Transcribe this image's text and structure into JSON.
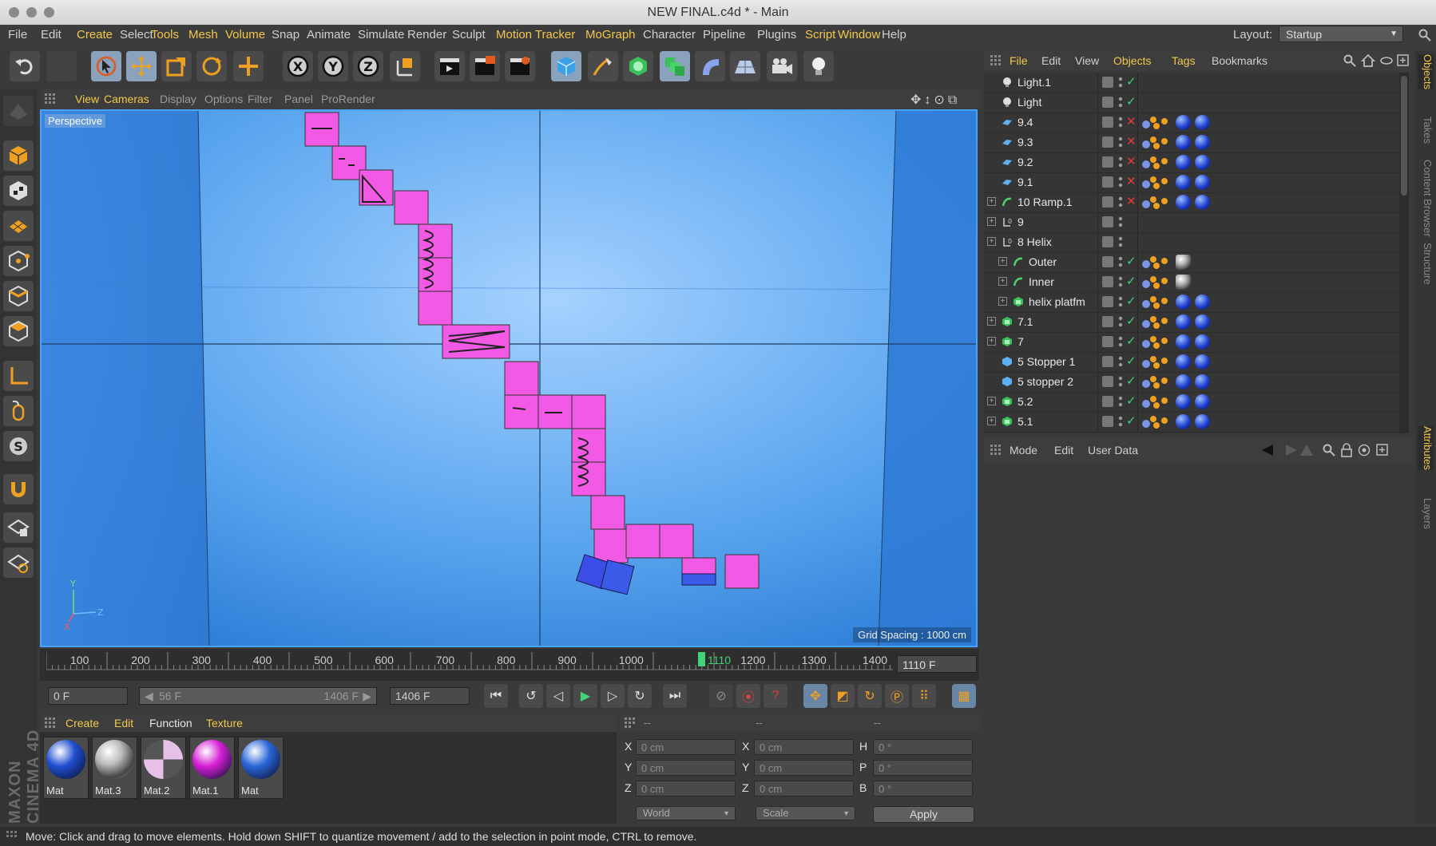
{
  "window": {
    "title": "NEW FINAL.c4d * - Main"
  },
  "menubar": {
    "items": [
      {
        "label": "File",
        "hl": false
      },
      {
        "label": "Edit",
        "hl": false
      },
      {
        "label": "Create",
        "hl": true
      },
      {
        "label": "Select",
        "hl": false
      },
      {
        "label": "Tools",
        "hl": true
      },
      {
        "label": "Mesh",
        "hl": true
      },
      {
        "label": "Volume",
        "hl": true
      },
      {
        "label": "Snap",
        "hl": false
      },
      {
        "label": "Animate",
        "hl": false
      },
      {
        "label": "Simulate",
        "hl": false
      },
      {
        "label": "Render",
        "hl": false
      },
      {
        "label": "Sculpt",
        "hl": false
      },
      {
        "label": "Motion Tracker",
        "hl": true
      },
      {
        "label": "MoGraph",
        "hl": true
      },
      {
        "label": "Character",
        "hl": false
      },
      {
        "label": "Pipeline",
        "hl": false
      },
      {
        "label": "Plugins",
        "hl": false
      },
      {
        "label": "Script",
        "hl": true
      },
      {
        "label": "Window",
        "hl": true
      },
      {
        "label": "Help",
        "hl": false
      }
    ],
    "layout_label": "Layout:",
    "layout_value": "Startup"
  },
  "viewport": {
    "menu": [
      {
        "label": "View",
        "hl": true
      },
      {
        "label": "Cameras",
        "hl": true
      },
      {
        "label": "Display",
        "hl": false
      },
      {
        "label": "Options",
        "hl": false
      },
      {
        "label": "Filter",
        "hl": false
      },
      {
        "label": "Panel",
        "hl": false
      },
      {
        "label": "ProRender",
        "hl": false
      }
    ],
    "camera_label": "Perspective",
    "grid_spacing": "Grid Spacing : 1000 cm",
    "axis_y": "Y",
    "axis_x": "X",
    "axis_z": "Z"
  },
  "timeline": {
    "ticks": [
      "100",
      "200",
      "300",
      "400",
      "500",
      "600",
      "700",
      "800",
      "900",
      "1000",
      "1100",
      "1200",
      "1300",
      "1400"
    ],
    "current_marker": "1110",
    "current_frame": "1110 F"
  },
  "transport": {
    "start_frame": "0 F",
    "range_start": "56 F",
    "range_end": "1406 F",
    "end_frame": "1406 F"
  },
  "materials": {
    "menu": [
      {
        "label": "Create",
        "hl": true
      },
      {
        "label": "Edit",
        "hl": true
      },
      {
        "label": "Function",
        "hl": false
      },
      {
        "label": "Texture",
        "hl": true
      }
    ],
    "items": [
      {
        "label": "Mat",
        "color": "#1f4fd0"
      },
      {
        "label": "Mat.3",
        "color": "#bfbfbf"
      },
      {
        "label": "Mat.2",
        "color": "#d9a0d9"
      },
      {
        "label": "Mat.1",
        "color": "#d61fd6"
      },
      {
        "label": "Mat",
        "color": "#2a66d8"
      }
    ],
    "brand": "MAXON CINEMA 4D"
  },
  "coordinates": {
    "headers": [
      "--",
      "--",
      "--"
    ],
    "rows": [
      {
        "l1": "X",
        "v1": "0 cm",
        "l2": "X",
        "v2": "0 cm",
        "l3": "H",
        "v3": "0 °"
      },
      {
        "l1": "Y",
        "v1": "0 cm",
        "l2": "Y",
        "v2": "0 cm",
        "l3": "P",
        "v3": "0 °"
      },
      {
        "l1": "Z",
        "v1": "0 cm",
        "l2": "Z",
        "v2": "0 cm",
        "l3": "B",
        "v3": "0 °"
      }
    ],
    "mode1": "World",
    "mode2": "Scale",
    "apply": "Apply"
  },
  "status": "Move: Click and drag to move elements. Hold down SHIFT to quantize movement / add to the selection in point mode, CTRL to remove.",
  "objects": {
    "menu": [
      {
        "label": "File",
        "hl": true
      },
      {
        "label": "Edit",
        "hl": false
      },
      {
        "label": "View",
        "hl": false
      },
      {
        "label": "Objects",
        "hl": true
      },
      {
        "label": "Tags",
        "hl": true
      },
      {
        "label": "Bookmarks",
        "hl": false
      }
    ],
    "rows": [
      {
        "name": "Light.1",
        "kind": "light",
        "indent": 0,
        "exp": false,
        "check": "green",
        "tags": []
      },
      {
        "name": "Light",
        "kind": "light",
        "indent": 0,
        "exp": false,
        "check": "green",
        "tags": []
      },
      {
        "name": "9.4",
        "kind": "plane",
        "indent": 0,
        "exp": false,
        "check": "red",
        "tags": [
          "dyn",
          "ball",
          "ball"
        ]
      },
      {
        "name": "9.3",
        "kind": "plane",
        "indent": 0,
        "exp": false,
        "check": "red",
        "tags": [
          "dyn",
          "ball",
          "ball"
        ]
      },
      {
        "name": "9.2",
        "kind": "plane",
        "indent": 0,
        "exp": false,
        "check": "red",
        "tags": [
          "dyn",
          "ball",
          "ball"
        ]
      },
      {
        "name": "9.1",
        "kind": "plane",
        "indent": 0,
        "exp": false,
        "check": "red",
        "tags": [
          "dyn",
          "ball",
          "ball"
        ]
      },
      {
        "name": "10 Ramp.1",
        "kind": "spline",
        "indent": 0,
        "exp": true,
        "check": "red",
        "tags": [
          "dyn",
          "ball",
          "ball"
        ]
      },
      {
        "name": "9",
        "kind": "null",
        "indent": 0,
        "exp": true,
        "check": "none",
        "tags": []
      },
      {
        "name": "8 Helix",
        "kind": "null",
        "indent": 0,
        "exp": true,
        "check": "none",
        "tags": []
      },
      {
        "name": "Outer",
        "kind": "spline",
        "indent": 1,
        "exp": true,
        "check": "green",
        "tags": [
          "dyn",
          "chrome"
        ]
      },
      {
        "name": "Inner",
        "kind": "spline",
        "indent": 1,
        "exp": true,
        "check": "green",
        "tags": [
          "dyn",
          "chrome"
        ]
      },
      {
        "name": "helix platfm",
        "kind": "cube",
        "indent": 1,
        "exp": true,
        "check": "green",
        "tags": [
          "dyn",
          "ball",
          "ball"
        ]
      },
      {
        "name": "7.1",
        "kind": "cube",
        "indent": 0,
        "exp": true,
        "check": "green",
        "tags": [
          "dyn",
          "ball",
          "ball"
        ]
      },
      {
        "name": "7",
        "kind": "cube",
        "indent": 0,
        "exp": true,
        "check": "green",
        "tags": [
          "dyn",
          "ball",
          "ball"
        ]
      },
      {
        "name": "5 Stopper 1",
        "kind": "box",
        "indent": 0,
        "exp": false,
        "check": "green",
        "tags": [
          "dyn",
          "ball",
          "ball"
        ]
      },
      {
        "name": "5 stopper 2",
        "kind": "box",
        "indent": 0,
        "exp": false,
        "check": "green",
        "tags": [
          "dyn",
          "ball",
          "ball"
        ]
      },
      {
        "name": "5.2",
        "kind": "cube",
        "indent": 0,
        "exp": true,
        "check": "green",
        "tags": [
          "dyn",
          "ball",
          "ball"
        ]
      },
      {
        "name": "5.1",
        "kind": "cube",
        "indent": 0,
        "exp": true,
        "check": "green",
        "tags": [
          "dyn",
          "ball",
          "ball"
        ]
      }
    ]
  },
  "attributes": {
    "menu": [
      "Mode",
      "Edit",
      "User Data"
    ]
  },
  "side_tabs": [
    {
      "label": "Objects",
      "hl": true
    },
    {
      "label": "Takes",
      "hl": false
    },
    {
      "label": "Content Browser",
      "hl": false
    },
    {
      "label": "Structure",
      "hl": false
    },
    {
      "label": "Attributes",
      "hl": true
    },
    {
      "label": "Layers",
      "hl": false
    }
  ],
  "colors": {
    "accent": "#f2c84b",
    "viewport_blue": "#3e8ee6",
    "platform_pink": "#f25ae6",
    "selection_blue": "#4aa2ff"
  }
}
